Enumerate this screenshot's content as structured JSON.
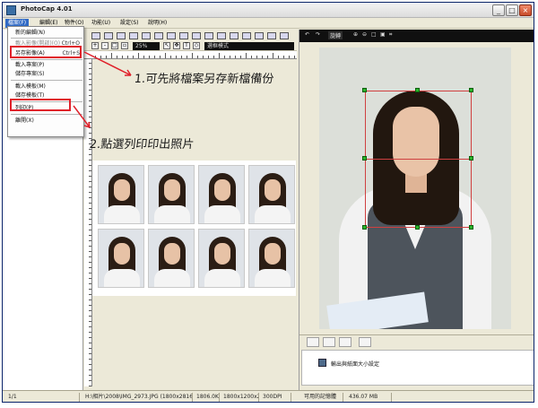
{
  "window": {
    "title": "PhotoCap 4.01"
  },
  "menu": [
    {
      "label": "檔案(F)"
    },
    {
      "label": "編輯(E)"
    },
    {
      "label": "物件(O)"
    },
    {
      "label": "功能(U)"
    },
    {
      "label": "設定(S)"
    },
    {
      "label": "說明(H)"
    }
  ],
  "file_menu": {
    "items": [
      {
        "label": "新的編輯(N)",
        "shortcut": "",
        "disabled": false
      },
      {
        "label": "載入影像(開啟)(O)",
        "shortcut": "Ctrl+O",
        "disabled": true
      },
      {
        "label": "另存影像(A)",
        "shortcut": "Ctrl+S",
        "disabled": false
      },
      {
        "label": "載入專案(P)",
        "shortcut": "",
        "disabled": false
      },
      {
        "label": "儲存專案(S)",
        "shortcut": "",
        "disabled": false
      },
      {
        "label": "載入模板(M)",
        "shortcut": "",
        "disabled": false
      },
      {
        "label": "儲存模板(T)",
        "shortcut": "",
        "disabled": false
      },
      {
        "label": "列印(P)",
        "shortcut": "",
        "disabled": false
      },
      {
        "label": "離開(X)",
        "shortcut": "",
        "disabled": false
      }
    ]
  },
  "mid_toolbar": {
    "zoom_value": "25%",
    "mode_label": "選框模式"
  },
  "right_toolbar": {
    "rotate_label": "旋轉"
  },
  "right_panel": {
    "output_setting_label": "輸出與紙面大小設定"
  },
  "annotations": {
    "step1": "1.可先將檔案另存新檔備份",
    "step2": "2.點選列印印出照片"
  },
  "status": {
    "page": "1/1",
    "path": "H:\\相片\\2008\\IMG_2973.JPG (1800x2816x24)",
    "size": "1806.0KB",
    "dims": "1800x1200x24b",
    "dpi": "300DPI",
    "mem_label": "可用的記憶體",
    "mem_value": "436.07 MB"
  },
  "colors": {
    "highlight": "#e0202a",
    "menu_select": "#316ac5",
    "handle": "#2bb52b"
  }
}
